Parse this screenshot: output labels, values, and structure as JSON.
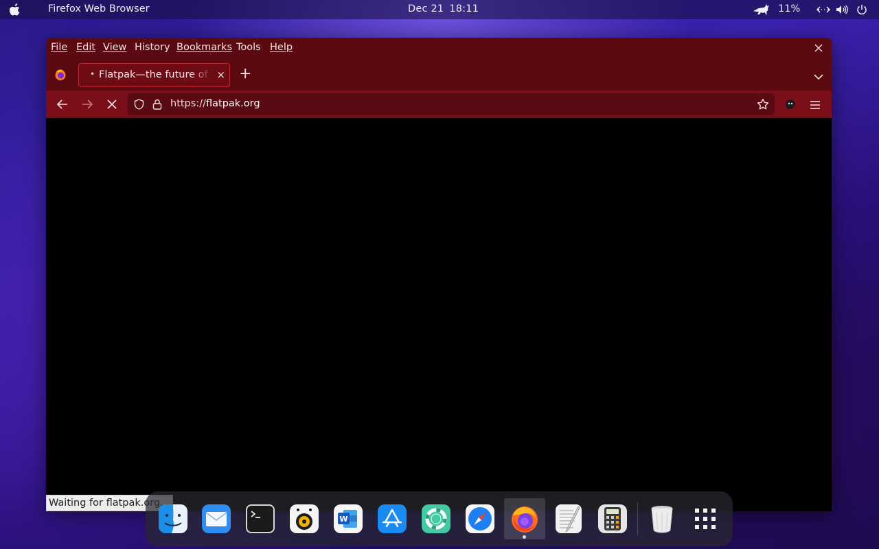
{
  "topbar": {
    "app_name": "Firefox Web Browser",
    "date": "Dec 21",
    "time": "18:11",
    "battery_percent": "11%",
    "tray_icons": [
      "cat-icon",
      "network-icon",
      "volume-icon",
      "power-icon"
    ]
  },
  "browser": {
    "menu": [
      "File",
      "Edit",
      "View",
      "History",
      "Bookmarks",
      "Tools",
      "Help"
    ],
    "tab": {
      "title": "Flatpak—the future of application distribution",
      "loading": true
    },
    "url": {
      "scheme": "https://",
      "host": "flatpak.org"
    },
    "status_text": "Waiting for flatpak.org...",
    "colors": {
      "menubar": "#5c0a12",
      "navbar": "#7a0e19",
      "content": "#000000"
    }
  },
  "dock": {
    "apps": [
      "finder-icon",
      "mail-icon",
      "terminal-icon",
      "rhythmbox-icon",
      "word-icon",
      "app-store-icon",
      "help-icon",
      "safari-icon",
      "firefox-icon",
      "text-editor-icon",
      "calculator-icon",
      "trash-icon",
      "app-grid-icon"
    ],
    "active_app": "firefox-icon"
  }
}
